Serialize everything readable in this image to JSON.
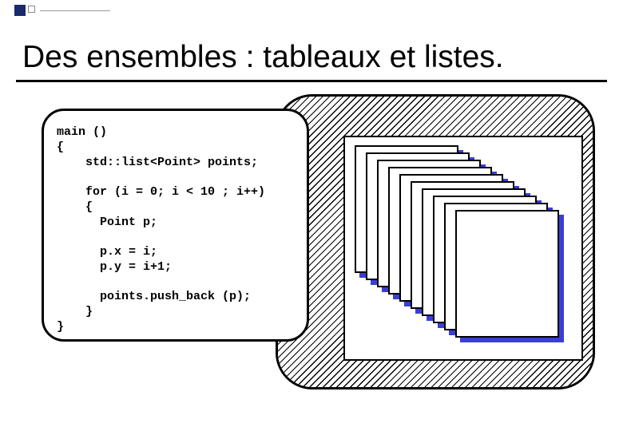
{
  "title": "Des ensembles : tableaux et listes.",
  "code": {
    "l1": "main ()",
    "l2": "{",
    "l3": "    std::list<Point> points;",
    "l4": "",
    "l5": "    for (i = 0; i < 10 ; i++)",
    "l6": "    {",
    "l7": "      Point p;",
    "l8": "",
    "l9": "      p.x = i;",
    "l10": "      p.y = i+1;",
    "l11": "",
    "l12": "      points.push_back (p);",
    "l13": "    }",
    "l14": "}"
  },
  "stack_count": 10
}
